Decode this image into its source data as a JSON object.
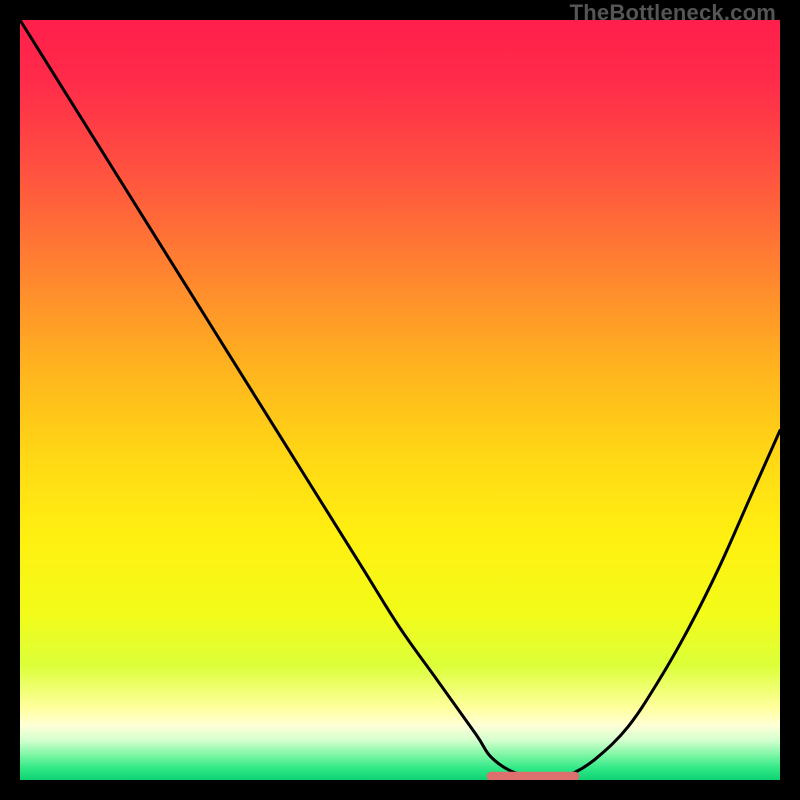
{
  "watermark": "TheBottleneck.com",
  "colors": {
    "frame": "#000000",
    "curve": "#000000",
    "flat_segment": "#dd6f6e",
    "grad_stops": [
      {
        "offset": 0.0,
        "color": "#ff1f4b"
      },
      {
        "offset": 0.08,
        "color": "#ff2b4a"
      },
      {
        "offset": 0.2,
        "color": "#ff5240"
      },
      {
        "offset": 0.33,
        "color": "#ff8330"
      },
      {
        "offset": 0.46,
        "color": "#ffb41e"
      },
      {
        "offset": 0.58,
        "color": "#ffd915"
      },
      {
        "offset": 0.68,
        "color": "#fff011"
      },
      {
        "offset": 0.78,
        "color": "#f3fb19"
      },
      {
        "offset": 0.85,
        "color": "#dcff3a"
      },
      {
        "offset": 0.905,
        "color": "#ffff9e"
      },
      {
        "offset": 0.928,
        "color": "#ffffd6"
      },
      {
        "offset": 0.948,
        "color": "#d3ffce"
      },
      {
        "offset": 0.965,
        "color": "#86f7a7"
      },
      {
        "offset": 0.985,
        "color": "#2fe886"
      },
      {
        "offset": 1.0,
        "color": "#0fd274"
      }
    ]
  },
  "chart_data": {
    "type": "line",
    "title": "",
    "xlabel": "",
    "ylabel": "",
    "xlim": [
      0,
      100
    ],
    "ylim": [
      0,
      100
    ],
    "legend": false,
    "grid": false,
    "annotations": [],
    "series": [
      {
        "name": "bottleneck-curve",
        "x": [
          0,
          5,
          10,
          15,
          20,
          25,
          30,
          35,
          40,
          45,
          50,
          55,
          60,
          62,
          65,
          68,
          71,
          73,
          76,
          80,
          84,
          88,
          92,
          96,
          100
        ],
        "y": [
          100,
          92,
          84,
          76,
          68,
          60,
          52,
          44,
          36,
          28,
          20,
          13,
          6,
          3,
          1,
          0.5,
          0.5,
          1,
          3,
          7,
          13,
          20,
          28,
          37,
          46
        ]
      },
      {
        "name": "optimal-flat-segment",
        "x": [
          62,
          73
        ],
        "y": [
          0.5,
          0.5
        ]
      }
    ]
  }
}
